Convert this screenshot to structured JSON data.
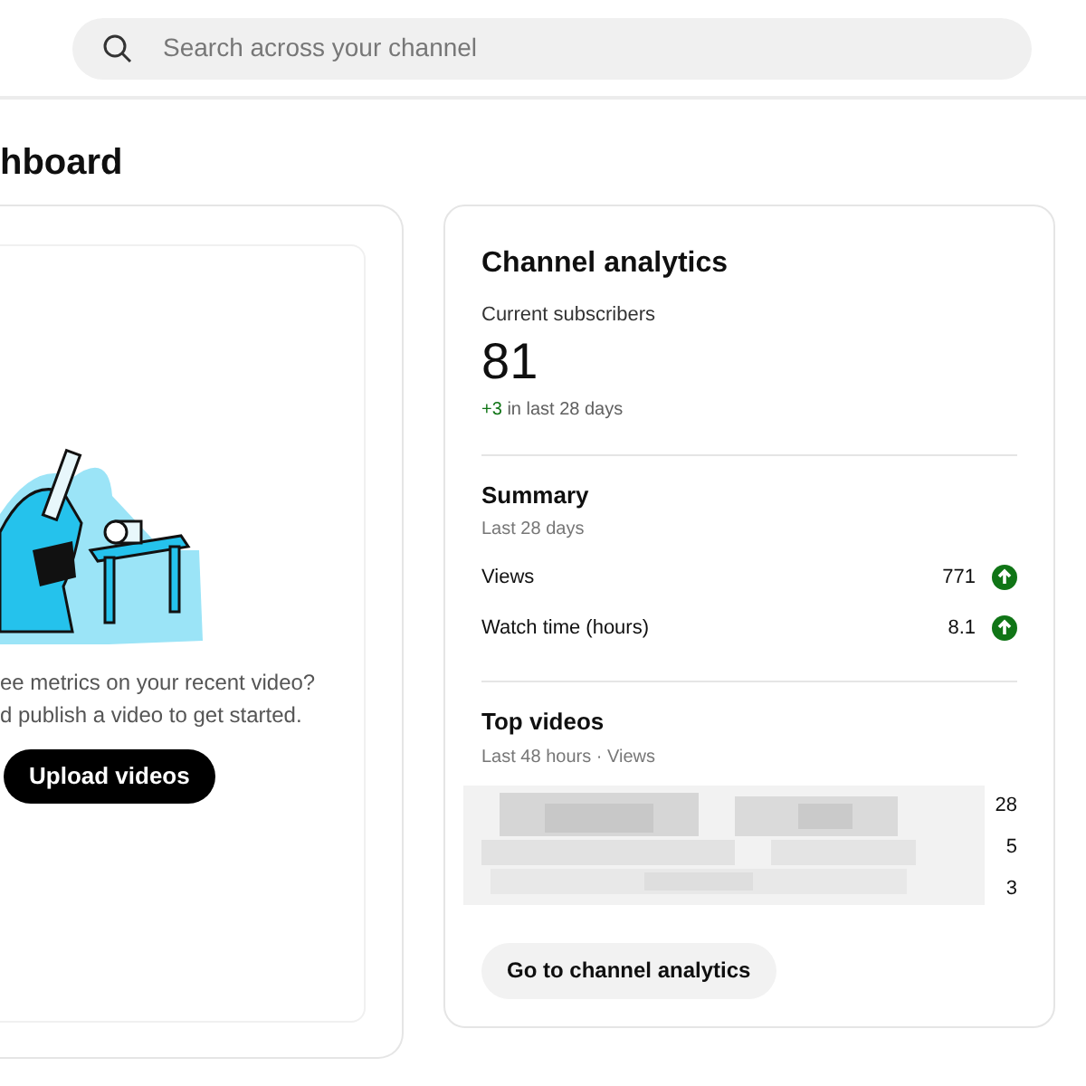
{
  "search": {
    "placeholder": "Search across your channel"
  },
  "page_title": "hboard",
  "upload_card": {
    "lines": [
      "ee metrics on your recent video?",
      "d publish a video to get started."
    ],
    "button": "Upload videos"
  },
  "analytics": {
    "title": "Channel analytics",
    "subscribers_label": "Current subscribers",
    "subscribers": "81",
    "change": "+3",
    "change_suffix": "in last 28 days",
    "summary": {
      "title": "Summary",
      "period": "Last 28 days",
      "metrics": [
        {
          "label": "Views",
          "value": "771",
          "increased": true
        },
        {
          "label": "Watch time (hours)",
          "value": "8.1",
          "increased": true
        }
      ]
    },
    "top_videos": {
      "title": "Top videos",
      "period": "Last 48 hours · Views",
      "counts": [
        "28",
        "5",
        "3"
      ]
    },
    "button": "Go to channel analytics"
  }
}
